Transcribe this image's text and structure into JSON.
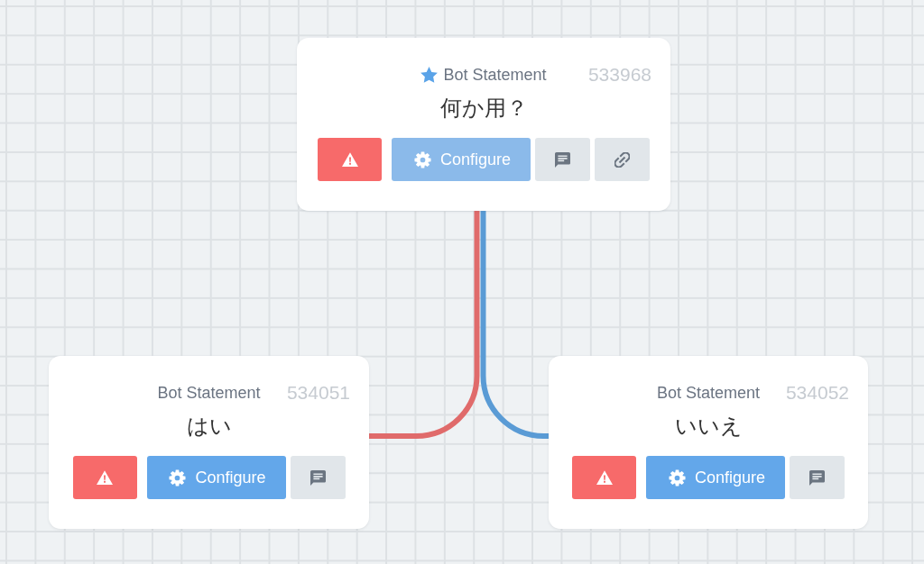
{
  "canvas": {
    "root": {
      "type_label": "Bot Statement",
      "starred": true,
      "node_number": "533968",
      "text": "何か用？",
      "buttons": [
        {
          "kind": "warning"
        },
        {
          "kind": "configure",
          "label": "Configure",
          "disabled": true
        },
        {
          "kind": "comment"
        },
        {
          "kind": "link"
        }
      ],
      "children": [
        {
          "color": "#e06b6b",
          "type_label": "Bot Statement",
          "starred": false,
          "node_number": "534051",
          "text": "はい",
          "buttons": [
            {
              "kind": "warning"
            },
            {
              "kind": "configure",
              "label": "Configure",
              "disabled": false
            },
            {
              "kind": "comment"
            }
          ]
        },
        {
          "color": "#5a9bd5",
          "type_label": "Bot Statement",
          "starred": false,
          "node_number": "534052",
          "text": "いいえ",
          "buttons": [
            {
              "kind": "warning"
            },
            {
              "kind": "configure",
              "label": "Configure",
              "disabled": false
            },
            {
              "kind": "comment"
            }
          ]
        }
      ]
    }
  }
}
